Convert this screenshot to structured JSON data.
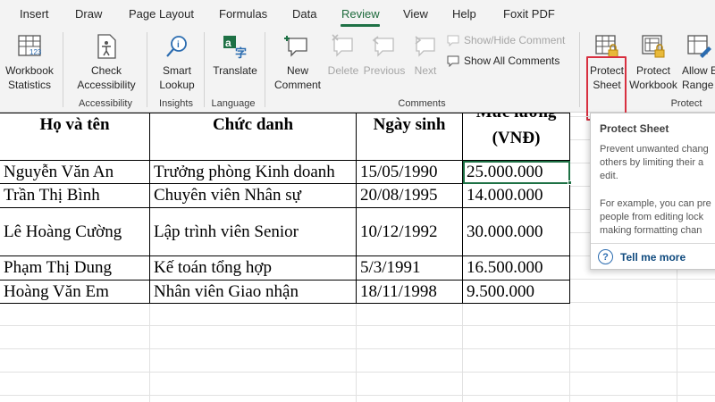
{
  "tabs": [
    {
      "label": "Insert"
    },
    {
      "label": "Draw"
    },
    {
      "label": "Page Layout"
    },
    {
      "label": "Formulas"
    },
    {
      "label": "Data"
    },
    {
      "label": "Review"
    },
    {
      "label": "View"
    },
    {
      "label": "Help"
    },
    {
      "label": "Foxit PDF"
    }
  ],
  "active_tab": "Review",
  "ribbon": {
    "workbook_statistics": "Workbook\nStatistics",
    "check_accessibility": "Check\nAccessibility",
    "smart_lookup": "Smart\nLookup",
    "translate": "Translate",
    "new_comment": "New\nComment",
    "delete": "Delete",
    "previous": "Previous",
    "next": "Next",
    "show_hide_comment": "Show/Hide Comment",
    "show_all_comments": "Show All Comments",
    "protect_sheet": "Protect\nSheet",
    "protect_workbook": "Protect\nWorkbook",
    "allow_edit_ranges": "Allow E\nRange",
    "groups": {
      "accessibility": "Accessibility",
      "insights": "Insights",
      "language": "Language",
      "comments": "Comments",
      "protect": "Protect"
    }
  },
  "table": {
    "headers": {
      "name": "Họ và tên",
      "title": "Chức danh",
      "dob": "Ngày sinh",
      "salary_line1": "Mức lương",
      "salary_line2": "(VNĐ)"
    },
    "rows": [
      {
        "name": "Nguyễn Văn An",
        "title": "Trưởng phòng Kinh doanh",
        "dob": "15/05/1990",
        "salary": "25.000.000"
      },
      {
        "name": "Trần Thị Bình",
        "title": "Chuyên viên Nhân sự",
        "dob": "20/08/1995",
        "salary": "14.000.000"
      },
      {
        "name": "Lê Hoàng Cường",
        "title": "Lập trình viên Senior",
        "dob": "10/12/1992",
        "salary": "30.000.000"
      },
      {
        "name": "Phạm Thị Dung",
        "title": "Kế toán tổng hợp",
        "dob": "5/3/1991",
        "salary": "16.500.000"
      },
      {
        "name": "Hoàng Văn Em",
        "title": "Nhân viên Giao nhận",
        "dob": "18/11/1998",
        "salary": "9.500.000"
      }
    ]
  },
  "tooltip": {
    "title": "Protect Sheet",
    "p1_line1": "Prevent unwanted chang",
    "p1_line2": "others by limiting their a",
    "p1_line3": "edit.",
    "p2_line1": "For example, you can pre",
    "p2_line2": "people from editing lock",
    "p2_line3": "making formatting chan",
    "link": "Tell me more"
  },
  "colors": {
    "accent_green": "#1e7145",
    "highlight_red": "#d83040",
    "link_blue": "#0f4a7e"
  }
}
